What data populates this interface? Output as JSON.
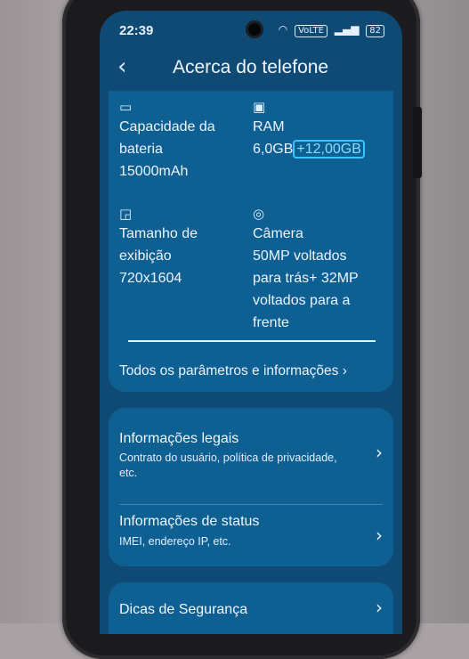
{
  "status_bar": {
    "time": "22:39",
    "battery": "82",
    "network": "VoLTE"
  },
  "header": {
    "title": "Acerca do telefone"
  },
  "specs": {
    "battery": {
      "label_line1": "Capacidade da",
      "label_line2": "bateria",
      "value": "15000mAh"
    },
    "ram": {
      "label": "RAM",
      "value": "6,0GB",
      "extended": "+12,00GB"
    },
    "display": {
      "label_line1": "Tamanho de",
      "label_line2": "exibição",
      "value": "720x1604"
    },
    "camera": {
      "label": "Câmera",
      "value_line1": "50MP voltados",
      "value_line2": "para trás+ 32MP",
      "value_line3": "voltados para a",
      "value_line4": "frente"
    }
  },
  "all_params": "Todos os parâmetros e informações ›",
  "menu": {
    "legal": {
      "title": "Informações legais",
      "subtitle": "Contrato do usuário, política de privacidade, etc."
    },
    "status": {
      "title": "Informações de status",
      "subtitle": "IMEI, endereço IP, etc."
    },
    "security": {
      "title": "Dicas de Segurança"
    }
  },
  "colors": {
    "screen_bg": "#0f4a74",
    "card_bg": "#0e5f92",
    "accent": "#3dc4ff"
  }
}
